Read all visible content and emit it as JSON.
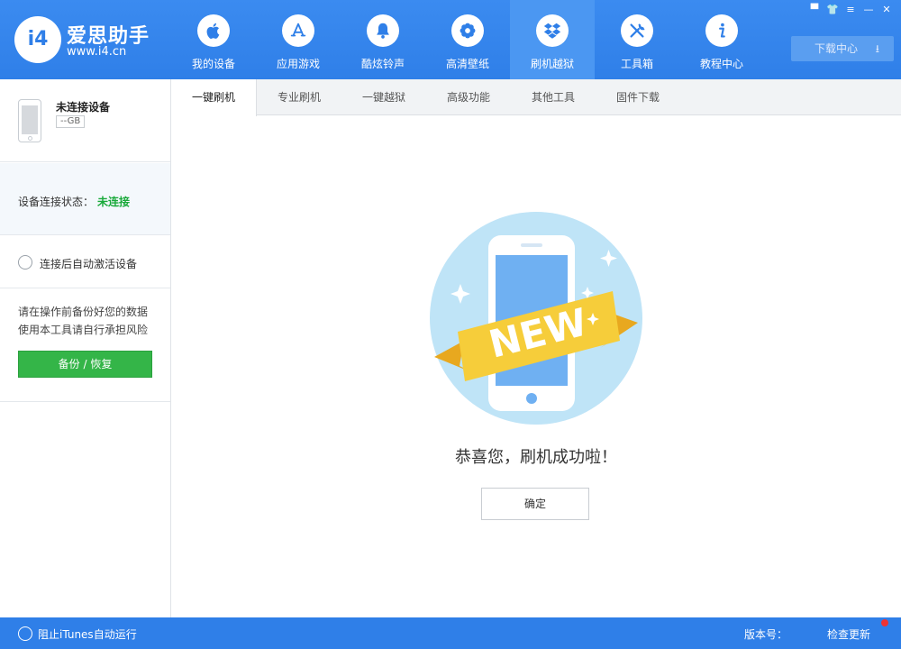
{
  "app": {
    "logo_text": "i4",
    "name": "爱思助手",
    "url": "www.i4.cn"
  },
  "nav": [
    {
      "label": "我的设备",
      "icon": "apple-icon"
    },
    {
      "label": "应用游戏",
      "icon": "app-store-icon"
    },
    {
      "label": "酷炫铃声",
      "icon": "bell-icon"
    },
    {
      "label": "高清壁纸",
      "icon": "flower-icon"
    },
    {
      "label": "刷机越狱",
      "icon": "dropbox-box-icon",
      "active": true
    },
    {
      "label": "工具箱",
      "icon": "tools-icon"
    },
    {
      "label": "教程中心",
      "icon": "info-icon"
    }
  ],
  "window_controls": [
    "feedback-icon",
    "skin-icon",
    "menu-icon",
    "minimize-icon",
    "close-icon"
  ],
  "download_center": {
    "label": "下载中心"
  },
  "device": {
    "name": "未连接设备",
    "capacity": "--GB"
  },
  "connection": {
    "label": "设备连接状态：",
    "value": "未连接"
  },
  "auto_activate": {
    "label": "连接后自动激活设备"
  },
  "warning": {
    "line1": "请在操作前备份好您的数据",
    "line2": "使用本工具请自行承担风险"
  },
  "backup_button": {
    "label": "备份 / 恢复"
  },
  "tabs": [
    {
      "label": "一键刷机",
      "active": true
    },
    {
      "label": "专业刷机"
    },
    {
      "label": "一键越狱"
    },
    {
      "label": "高级功能"
    },
    {
      "label": "其他工具"
    },
    {
      "label": "固件下载"
    }
  ],
  "illustration": {
    "banner_text": "NEW"
  },
  "success_message": "恭喜您，刷机成功啦！",
  "ok_button": {
    "label": "确定"
  },
  "footer": {
    "itunes_label": "阻止iTunes自动运行",
    "version_label": "版本号：",
    "update_label": "检查更新"
  },
  "colors": {
    "primary": "#2f7fe8",
    "success_green": "#34b548",
    "status_green": "#19a93a",
    "banner_yellow": "#f6cd3a",
    "illustration_circle": "#bfe4f7"
  }
}
